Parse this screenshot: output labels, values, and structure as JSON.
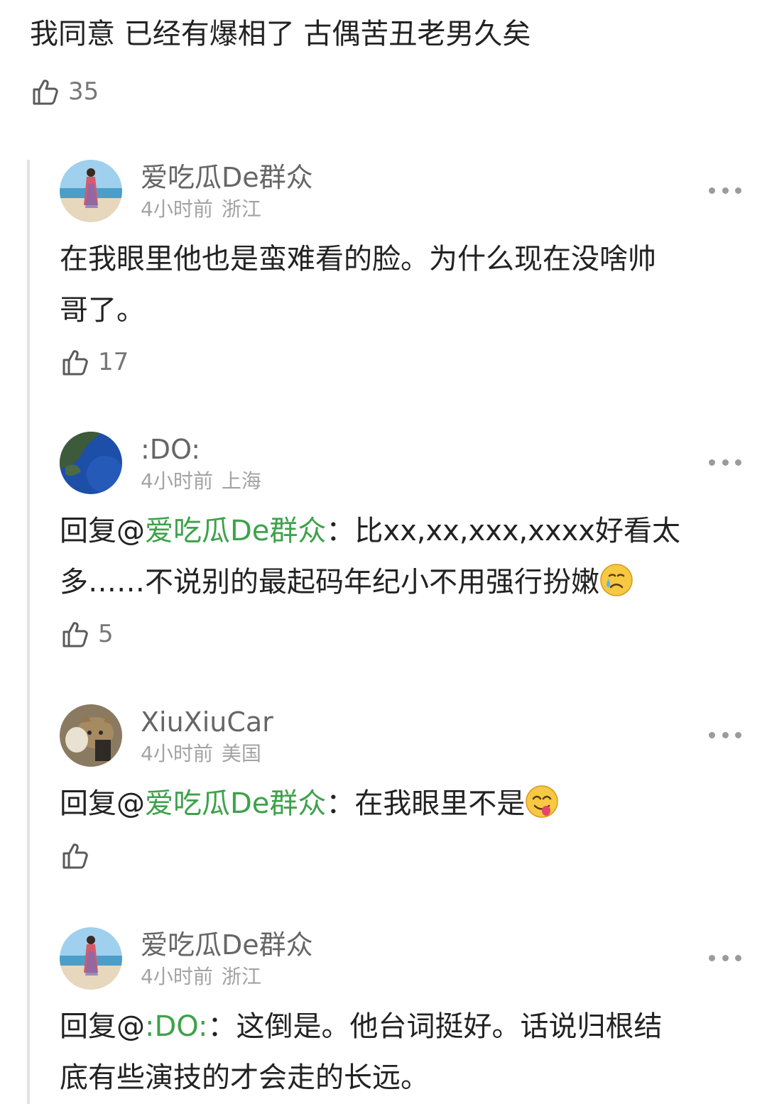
{
  "top_comment": {
    "text": "我同意 已经有爆相了 古偶苦丑老男久矣",
    "likes": "35"
  },
  "replies": [
    {
      "user": "爱吃瓜De群众",
      "time": "4小时前",
      "location": "浙江",
      "text_line1": "在我眼里他也是蛮难看的脸。为什么现在没啥帅",
      "text_line2": "哥了。",
      "likes": "17",
      "avatar_icon": "woman-on-beach-avatar"
    },
    {
      "user": ":DO:",
      "time": "4小时前",
      "location": "上海",
      "reply_prefix": "回复@",
      "mention": "爱吃瓜De群众",
      "separator": "：",
      "text_line1": "比xx,xx,xxx,xxxx好看太",
      "text_line2": "多……不说别的最起码年纪小不用强行扮嫩",
      "emoji": "crying-face-emoji",
      "likes": "5",
      "avatar_icon": "earth-map-avatar"
    },
    {
      "user": "XiuXiuCar",
      "time": "4小时前",
      "location": "美国",
      "reply_prefix": "回复@",
      "mention": "爱吃瓜De群众",
      "separator": "：",
      "text_line1": "在我眼里不是",
      "emoji": "yum-face-emoji",
      "likes": "",
      "avatar_icon": "cat-avatar"
    },
    {
      "user": "爱吃瓜De群众",
      "time": "4小时前",
      "location": "浙江",
      "reply_prefix": "回复@",
      "mention": ":DO:",
      "separator": "：",
      "text_line1": "这倒是。他台词挺好。话说归根结",
      "text_line2": "底有些演技的才会走的长远。",
      "avatar_icon": "woman-on-beach-avatar"
    }
  ],
  "colors": {
    "mention": "#3ea24b",
    "meta": "#a3a3a3",
    "username": "#666666",
    "thread_line": "#e3e3e3"
  }
}
